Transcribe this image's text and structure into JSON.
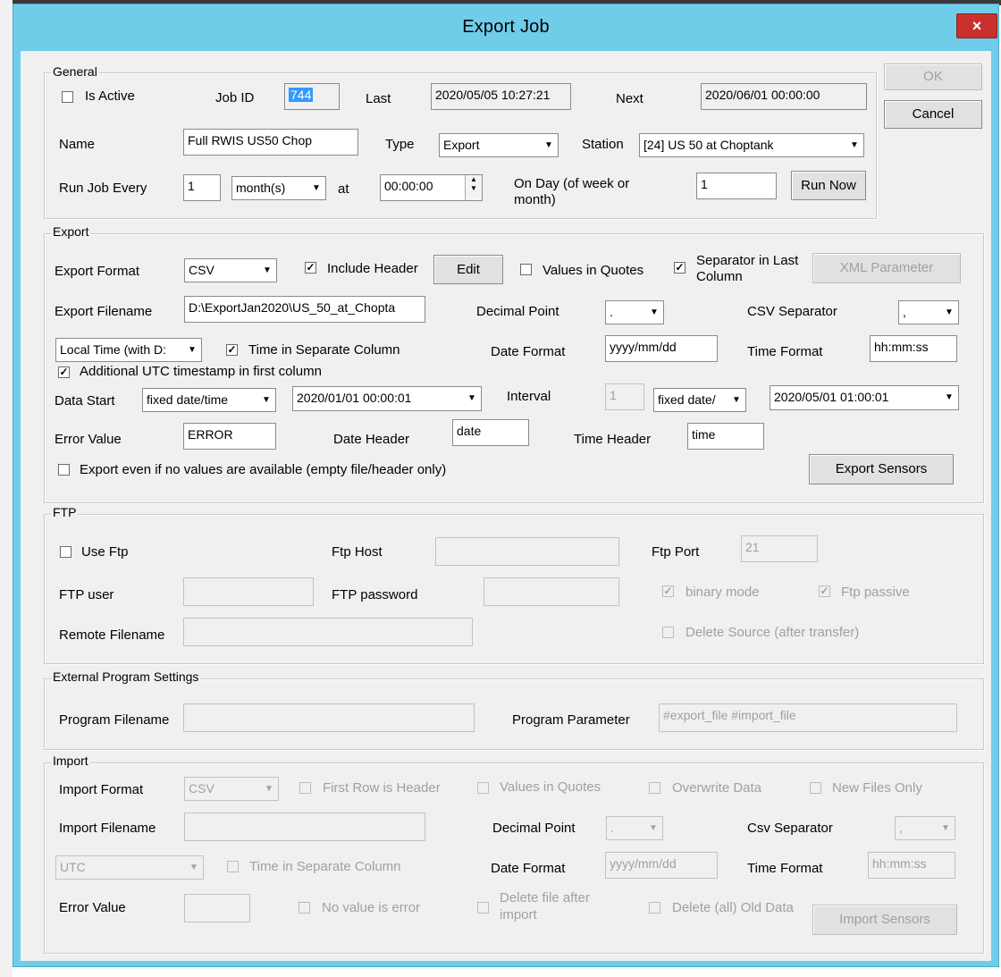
{
  "window": {
    "title": "Export Job",
    "close_glyph": "×"
  },
  "buttons": {
    "ok": "OK",
    "cancel": "Cancel",
    "run_now": "Run Now",
    "edit": "Edit",
    "xml_parameter": "XML Parameter",
    "export_sensors": "Export Sensors",
    "import_sensors": "Import Sensors"
  },
  "general": {
    "title": "General",
    "is_active": {
      "label": "Is Active",
      "checked": ""
    },
    "job_id_label": "Job ID",
    "job_id": "744",
    "last_label": "Last",
    "last": "2020/05/05 10:27:21",
    "next_label": "Next",
    "next": "2020/06/01 00:00:00",
    "name_label": "Name",
    "name": "Full RWIS US50 Chop",
    "type_label": "Type",
    "type": "Export",
    "station_label": "Station",
    "station": "[24] US 50 at Choptank",
    "run_every_label": "Run Job Every",
    "run_every": "1",
    "unit": "month(s)",
    "at_label": "at",
    "at_time": "00:00:00",
    "on_day_label": "On Day (of week or",
    "on_day_label2": "month)",
    "on_day": "1"
  },
  "export": {
    "title": "Export",
    "format_label": "Export Format",
    "format": "CSV",
    "include_header": {
      "label": "Include Header",
      "checked": "✓"
    },
    "values_in_quotes": {
      "label": "Values in Quotes",
      "checked": ""
    },
    "separator_last": {
      "label": "Separator in Last",
      "label2": "Column",
      "checked": "✓"
    },
    "filename_label": "Export Filename",
    "filename": "D:\\ExportJan2020\\US_50_at_Chopta",
    "decimal_label": "Decimal Point",
    "decimal": ".",
    "csv_sep_label": "CSV Separator",
    "csv_sep": ",",
    "time_zone": "Local Time (with D:",
    "time_separate": {
      "label": "Time in Separate Column",
      "checked": "✓"
    },
    "date_format_label": "Date Format",
    "date_format": "yyyy/mm/dd",
    "time_format_label": "Time Format",
    "time_format": "hh:mm:ss",
    "utc_first": {
      "label": "Additional UTC timestamp in first column",
      "checked": "✓"
    },
    "data_start_label": "Data Start",
    "data_start": "fixed date/time",
    "start_date": "2020/01/01 00:00:01",
    "interval_label": "Interval",
    "interval": "1",
    "interval_unit": "fixed date/",
    "end_date": "2020/05/01 01:00:01",
    "error_label": "Error Value",
    "error": "ERROR",
    "date_header_label": "Date Header",
    "date_header": "date",
    "time_header_label": "Time Header",
    "time_header": "time",
    "export_empty": {
      "label": "Export even if no values are available (empty file/header only)",
      "checked": ""
    }
  },
  "ftp": {
    "title": "FTP",
    "use_ftp": {
      "label": "Use Ftp",
      "checked": ""
    },
    "host_label": "Ftp Host",
    "host": "",
    "port_label": "Ftp Port",
    "port": "21",
    "user_label": "FTP user",
    "user": "",
    "password_label": "FTP password",
    "password": "",
    "binary": {
      "label": "binary mode",
      "checked": "✓"
    },
    "passive": {
      "label": "Ftp passive",
      "checked": "✓"
    },
    "remote_label": "Remote Filename",
    "remote": "",
    "delete_source": {
      "label": "Delete Source (after transfer)",
      "checked": ""
    }
  },
  "external": {
    "title": "External Program Settings",
    "program_label": "Program Filename",
    "program": "",
    "param_label": "Program Parameter",
    "param": "#export_file #import_file"
  },
  "import": {
    "title": "Import",
    "format_label": "Import Format",
    "format": "CSV",
    "first_row": {
      "label": "First Row is Header",
      "checked": ""
    },
    "quotes": {
      "label": "Values in Quotes",
      "checked": ""
    },
    "overwrite": {
      "label": "Overwrite Data",
      "checked": ""
    },
    "new_only": {
      "label": "New Files Only",
      "checked": ""
    },
    "filename_label": "Import Filename",
    "filename": "",
    "decimal_label": "Decimal Point",
    "decimal": ".",
    "csv_sep_label": "Csv Separator",
    "csv_sep": ",",
    "time_zone": "UTC",
    "time_separate": {
      "label": "Time in Separate Column",
      "checked": ""
    },
    "date_format_label": "Date Format",
    "date_format": "yyyy/mm/dd",
    "time_format_label": "Time Format",
    "time_format": "hh:mm:ss",
    "error_label": "Error Value",
    "error": "",
    "no_value_error": {
      "label": "No value is error",
      "checked": ""
    },
    "delete_after": {
      "label": "Delete file after",
      "label2": "import",
      "checked": ""
    },
    "delete_old": {
      "label": "Delete (all) Old Data",
      "checked": ""
    }
  }
}
